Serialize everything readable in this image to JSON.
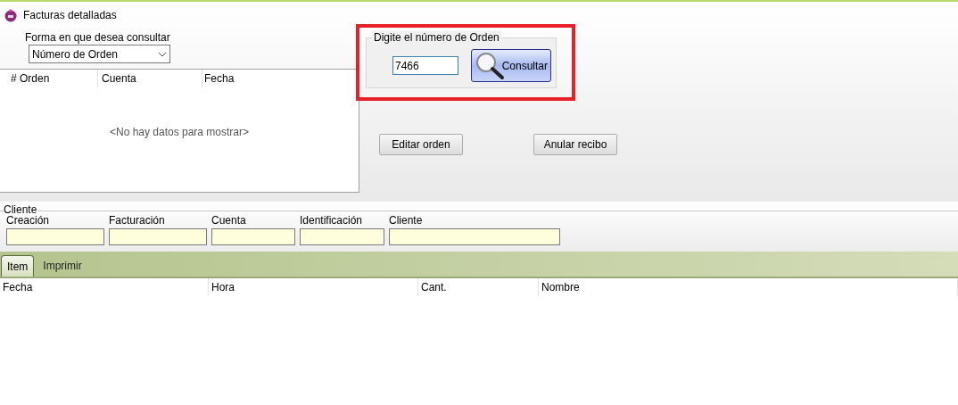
{
  "window": {
    "title": "Facturas detalladas"
  },
  "query_mode": {
    "label": "Forma en que desea consultar",
    "value": "Número de Orden"
  },
  "orders_grid": {
    "columns": [
      "# Orden",
      "Cuenta",
      "Fecha"
    ],
    "empty_message": "<No hay datos para mostrar>"
  },
  "order_search": {
    "label": "Digite el número de Orden",
    "value": "7466",
    "button": "Consultar"
  },
  "actions": [
    "Editar orden",
    "Anular recibo"
  ],
  "client": {
    "title": "Cliente",
    "fields": [
      {
        "label": "Creación"
      },
      {
        "label": "Facturación"
      },
      {
        "label": "Cuenta"
      },
      {
        "label": "Identificación"
      },
      {
        "label": "Cliente"
      }
    ]
  },
  "tabs": [
    {
      "label": "Item",
      "selected": true
    },
    {
      "label": "Imprimir",
      "selected": false
    }
  ],
  "items_grid": {
    "columns": [
      "Fecha",
      "Hora",
      "Cant.",
      "Nombre"
    ]
  }
}
